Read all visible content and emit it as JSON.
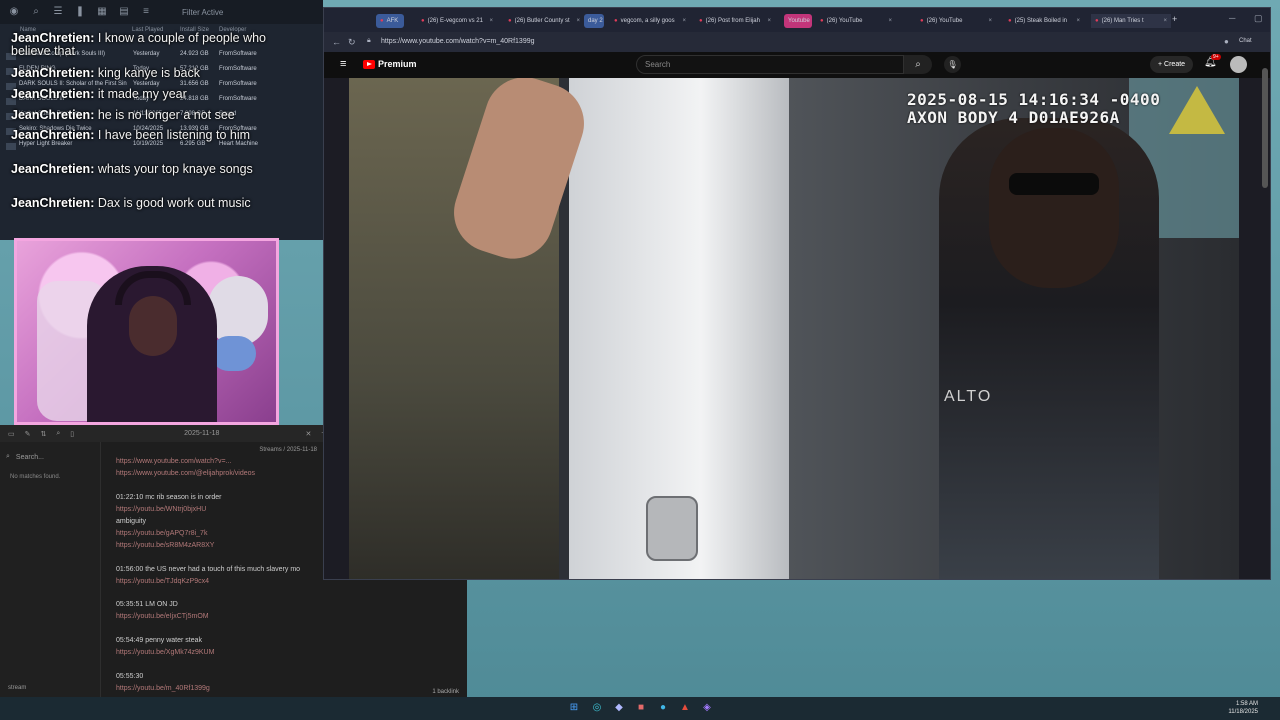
{
  "steam": {
    "filter_label": "Filter Active",
    "columns": {
      "name": "Name",
      "last_played": "Last Played",
      "install_size": "Install Size",
      "developer": "Developer"
    },
    "rows": [
      {
        "name": "Seamless Co-op (Dark Souls III)",
        "last_played": "Yesterday",
        "size": "24.923 GB",
        "developer": "FromSoftware"
      },
      {
        "name": "ELDEN RING",
        "last_played": "Today",
        "size": "57.212 GB",
        "developer": "FromSoftware"
      },
      {
        "name": "DARK SOULS II: Scholar of the First Sin",
        "last_played": "Yesterday",
        "size": "31.656 GB",
        "developer": "FromSoftware"
      },
      {
        "name": "DARK SOULS III",
        "last_played": "Today",
        "size": "24.818 GB",
        "developer": "FromSoftware"
      },
      {
        "name": "Kerbal Space Program",
        "last_played": "11/11/2025",
        "size": "7.998 GB",
        "developer": "Squad"
      },
      {
        "name": "Sekiro: Shadows Die Twice",
        "last_played": "10/24/2025",
        "size": "13.939 GB",
        "developer": "FromSoftware"
      },
      {
        "name": "Hyper Light Breaker",
        "last_played": "10/19/2025",
        "size": "6.295 GB",
        "developer": "Heart Machine"
      }
    ]
  },
  "chat": [
    {
      "user": "JeanChretien:",
      "text": "I know a couple of people who believe that"
    },
    {
      "user": "JeanChretien:",
      "text": "king kanye is back"
    },
    {
      "user": "JeanChretien:",
      "text": "it made my year"
    },
    {
      "user": "JeanChretien:",
      "text": "he is no longer a not see"
    },
    {
      "user": "JeanChretien:",
      "text": "I have been listening to him"
    },
    {
      "user": "JeanChretien:",
      "text": "whats your top knaye songs"
    },
    {
      "user": "JeanChretien:",
      "text": "Dax is good work out music"
    }
  ],
  "notes": {
    "tab_date": "2025-11-18",
    "search_placeholder": "Search...",
    "no_matches": "No matches found.",
    "breadcrumb": "Streams / 2025-11-18",
    "lines": [
      {
        "kind": "link",
        "text": "https://www.youtube.com/watch?v=..."
      },
      {
        "kind": "link",
        "text": "https://www.youtube.com/@elijahprok/videos"
      },
      {
        "kind": "text",
        "text": "01:22:10 mc rib season is in order"
      },
      {
        "kind": "link",
        "text": "https://youtu.be/WNtrj0bjxHU"
      },
      {
        "kind": "text",
        "text": "ambiguity"
      },
      {
        "kind": "link",
        "text": "https://youtu.be/gAPQ7r8i_7k"
      },
      {
        "kind": "link",
        "text": "https://youtu.be/sR8M4zAR8XY"
      },
      {
        "kind": "text",
        "text": "01:56:00 the US never had a touch of this much slavery mo"
      },
      {
        "kind": "link",
        "text": "https://youtu.be/TJdqKzP9cx4"
      },
      {
        "kind": "text",
        "text": "05:35:51 LM ON JD"
      },
      {
        "kind": "link",
        "text": "https://youtu.be/eIjxCTj5mOM"
      },
      {
        "kind": "text",
        "text": "05:54:49 penny water steak"
      },
      {
        "kind": "link",
        "text": "https://youtu.be/XgMk74z9KUM"
      },
      {
        "kind": "text",
        "text": "05:55:30"
      },
      {
        "kind": "link",
        "text": "https://youtu.be/m_40Rf1399g"
      }
    ],
    "vault_name": "stream",
    "backlinks": "1 backlink"
  },
  "browser": {
    "tabs": [
      {
        "label": "AFK"
      },
      {
        "label": "(26) E-vegcom vs 21"
      },
      {
        "label": "(26) Butler County st"
      },
      {
        "label": "vegcom, a silly goos"
      },
      {
        "label": "(26) Post from Elijah"
      },
      {
        "label": "(26) YouTube"
      },
      {
        "label": "(26) YouTube"
      },
      {
        "label": "(25) Steak Boiled in"
      },
      {
        "label": "(26) Man Tries t"
      }
    ],
    "group_labels": {
      "g1": "day 2",
      "g2": "Youtube"
    },
    "url": "https://www.youtube.com/watch?v=m_40Rf1399g",
    "chat_label": "Chat"
  },
  "youtube": {
    "brand": "Premium",
    "search_placeholder": "Search",
    "create_label": "Create",
    "notif_count": "9+"
  },
  "video": {
    "timestamp": "2025-08-15 14:16:34 -0400",
    "camera_id": "AXON BODY 4 D01AE926A",
    "shirt_text": "ALTO"
  },
  "taskbar": {
    "time": "1:58 AM",
    "date": "11/18/2025"
  }
}
